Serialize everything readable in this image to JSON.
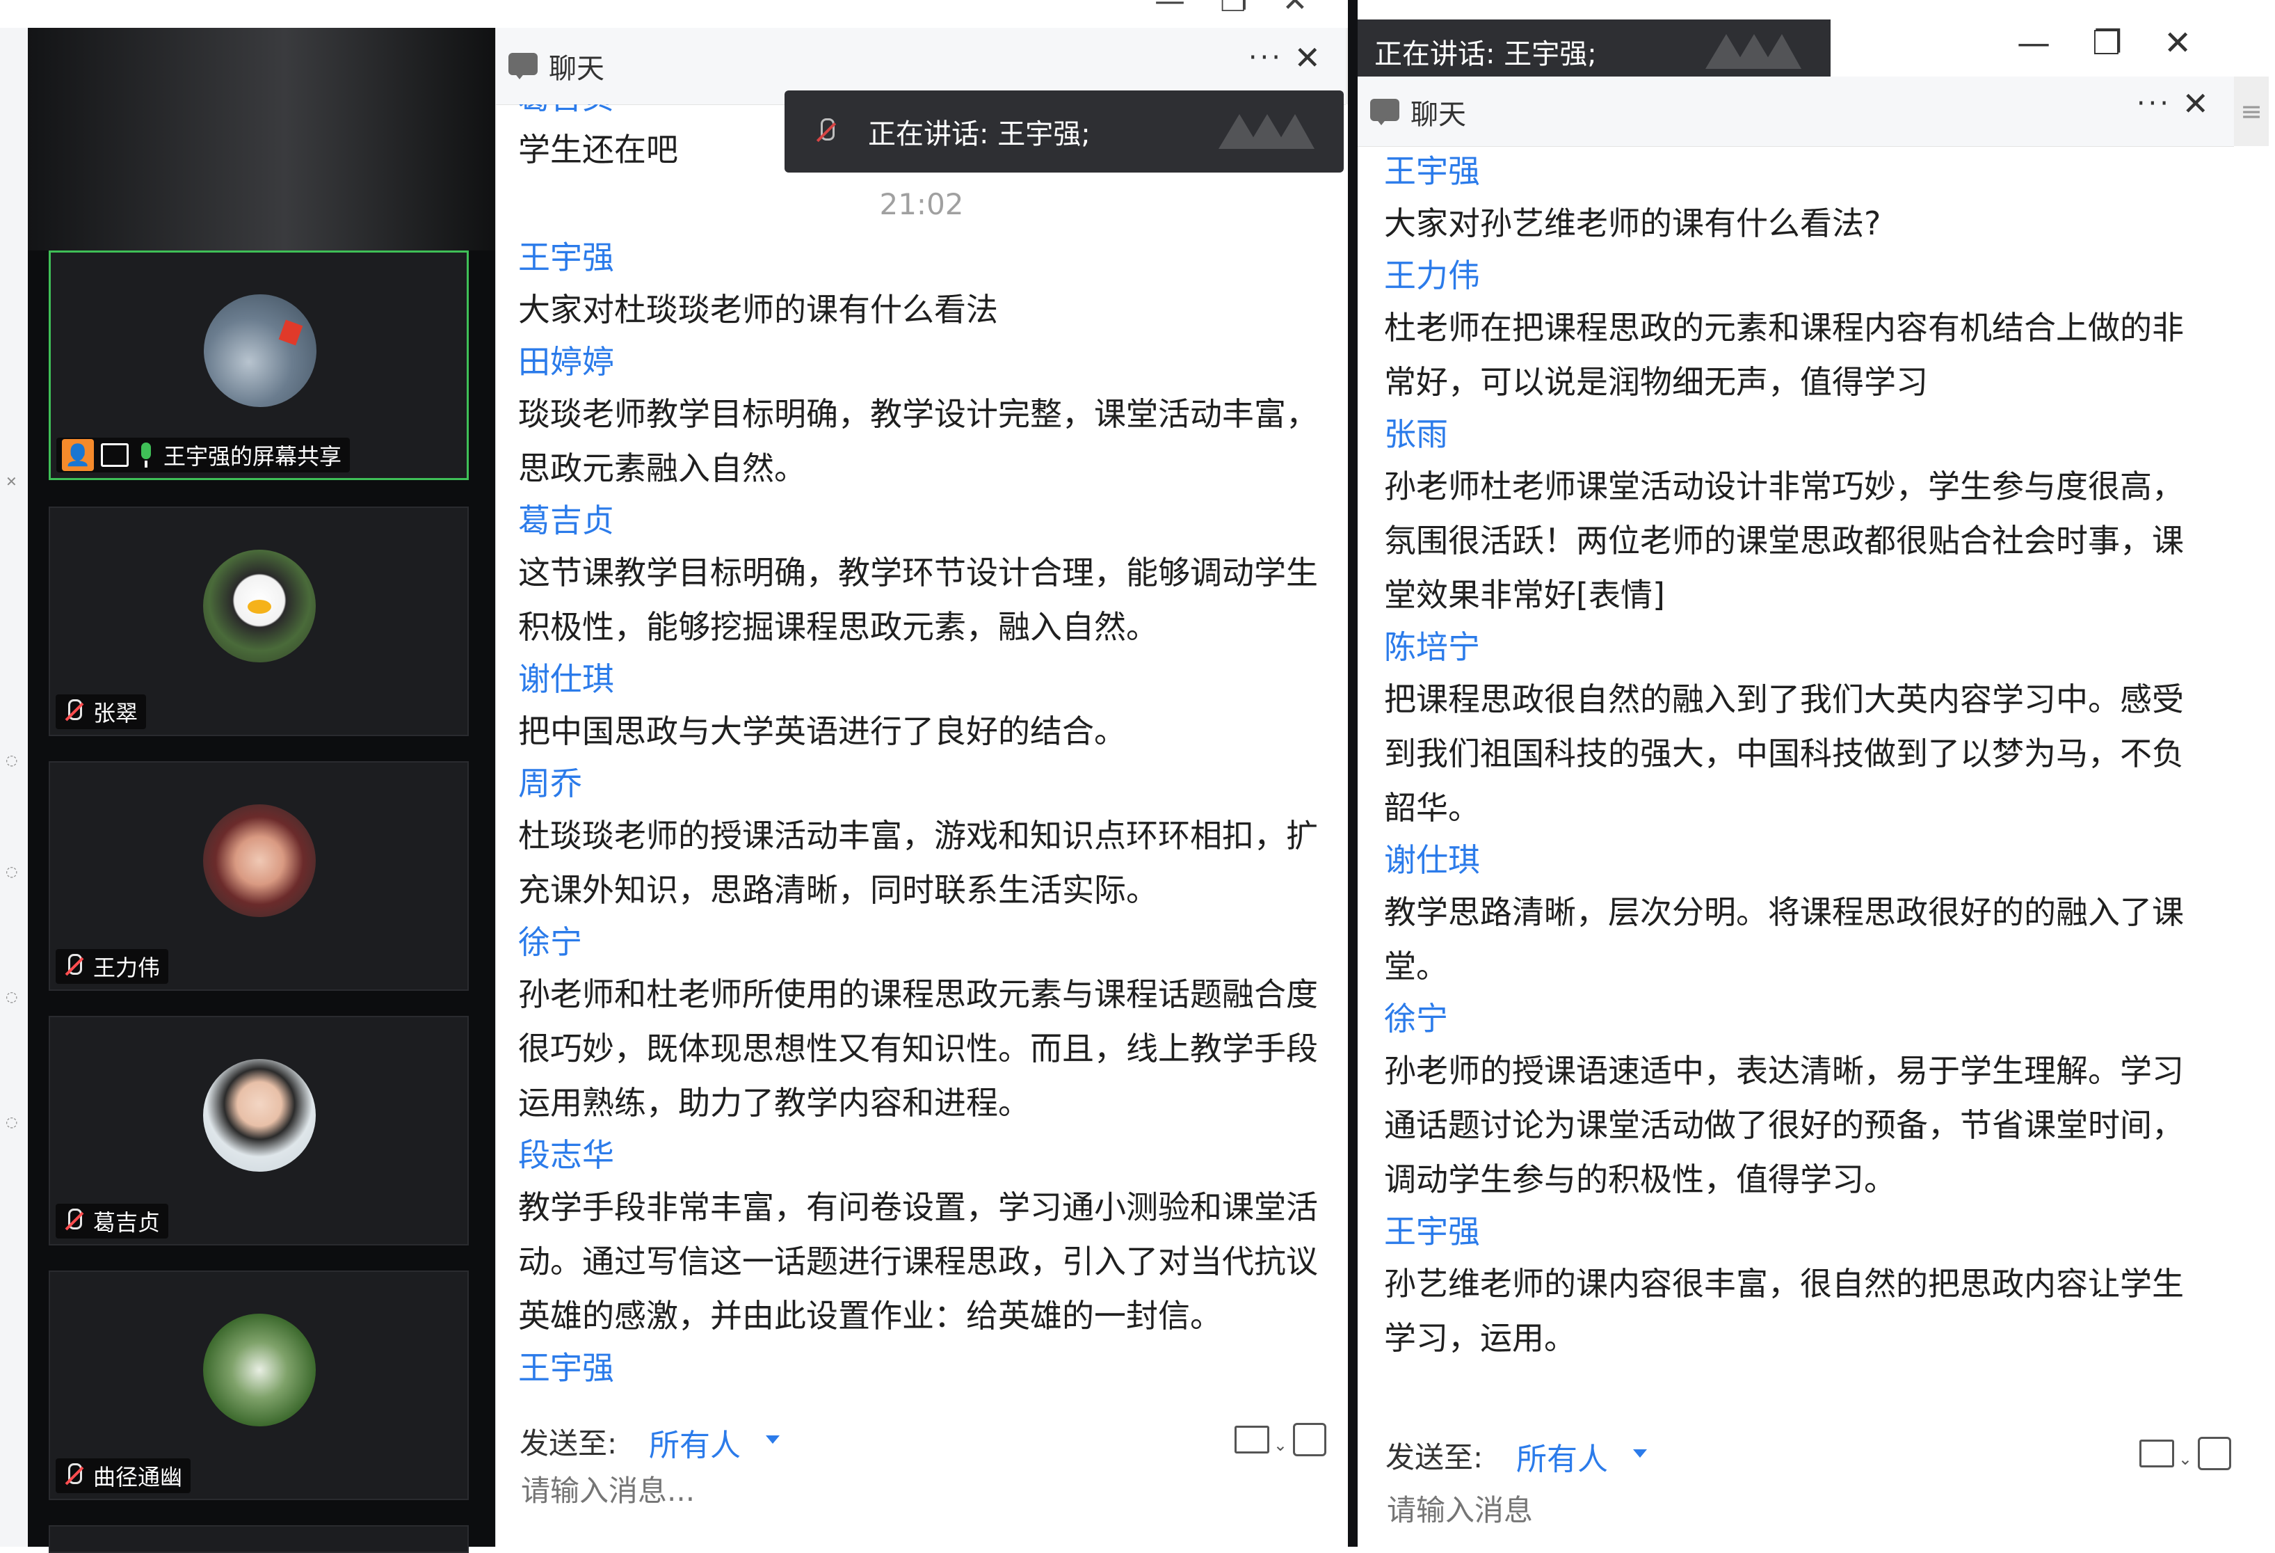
{
  "speaking_banner": "正在讲话: 王宇强;",
  "video": {
    "screen_share_label": "王宇强的屏幕共享",
    "participants": [
      {
        "name": "张翠"
      },
      {
        "name": "王力伟"
      },
      {
        "name": "葛吉贞"
      },
      {
        "name": "曲径通幽"
      }
    ]
  },
  "panel1": {
    "title": "聊天",
    "more": "···",
    "close": "✕",
    "cut_name_top": "葛吉贞",
    "first_text": "学生还在吧",
    "time": "21:02",
    "messages": [
      {
        "name": "王宇强",
        "text": "大家对杜琰琰老师的课有什么看法"
      },
      {
        "name": "田婷婷",
        "text": "琰琰老师教学目标明确，教学设计完整，课堂活动丰富，思政元素融入自然。"
      },
      {
        "name": "葛吉贞",
        "text": "这节课教学目标明确，教学环节设计合理，能够调动学生积极性，能够挖掘课程思政元素，融入自然。"
      },
      {
        "name": "谢仕琪",
        "text": "把中国思政与大学英语进行了良好的结合。"
      },
      {
        "name": "周乔",
        "text": "杜琰琰老师的授课活动丰富，游戏和知识点环环相扣，扩充课外知识，思路清晰，同时联系生活实际。"
      },
      {
        "name": "徐宁",
        "text": "孙老师和杜老师所使用的课程思政元素与课程话题融合度很巧妙，既体现思想性又有知识性。而且，线上教学手段运用熟练，助力了教学内容和进程。"
      },
      {
        "name": "段志华",
        "text": "教学手段非常丰富，有问卷设置，学习通小测验和课堂活动。通过写信这一话题进行课程思政，引入了对当代抗议英雄的感激，并由此设置作业：给英雄的一封信。"
      },
      {
        "name": "王宇强",
        "text": ""
      }
    ],
    "footer": {
      "send_to_label": "发送至:",
      "target": "所有人",
      "placeholder": "请输入消息..."
    }
  },
  "panel2": {
    "title": "聊天",
    "more": "···",
    "close": "✕",
    "messages": [
      {
        "name": "王宇强",
        "text": "大家对孙艺维老师的课有什么看法?"
      },
      {
        "name": "王力伟",
        "text": "杜老师在把课程思政的元素和课程内容有机结合上做的非常好，可以说是润物细无声，值得学习"
      },
      {
        "name": "张雨",
        "text": "孙老师杜老师课堂活动设计非常巧妙，学生参与度很高，氛围很活跃！两位老师的课堂思政都很贴合社会时事，课堂效果非常好[表情]"
      },
      {
        "name": "陈培宁",
        "text": "把课程思政很自然的融入到了我们大英内容学习中。感受到我们祖国科技的强大，中国科技做到了以梦为马，不负韶华。"
      },
      {
        "name": "谢仕琪",
        "text": "教学思路清晰，层次分明。将课程思政很好的的融入了课堂。"
      },
      {
        "name": "徐宁",
        "text": "孙老师的授课语速适中，表达清晰，易于学生理解。学习通话题讨论为课堂活动做了很好的预备，节省课堂时间，调动学生参与的积极性，值得学习。"
      },
      {
        "name": "王宇强",
        "text": "孙艺维老师的课内容很丰富，很自然的把思政内容让学生学习，运用。"
      }
    ],
    "footer": {
      "send_to_label": "发送至:",
      "target": "所有人",
      "placeholder": "请输入消息"
    }
  },
  "window_controls": {
    "minimize": "—",
    "restore": "❐",
    "close": "✕"
  },
  "colors": {
    "link_blue": "#2b7bea",
    "active_green": "#3fbf57",
    "host_orange": "#f58a2b",
    "mic_red": "#ff4d4f"
  }
}
